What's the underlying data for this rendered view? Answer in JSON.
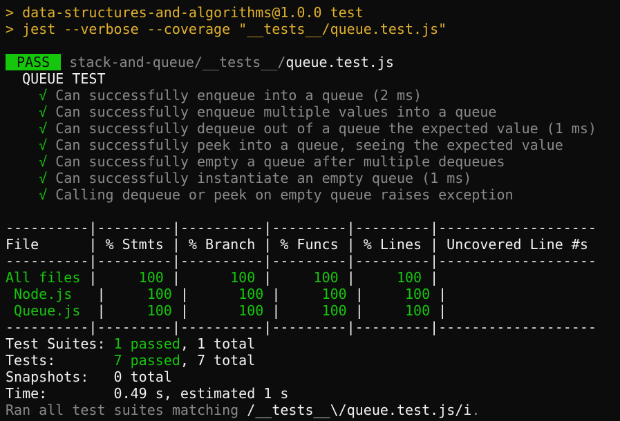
{
  "terminal": {
    "cmd_line1": "> data-structures-and-algorithms@1.0.0 test",
    "cmd_line2": "> jest --verbose --coverage \"__tests__/queue.test.js\"",
    "pass_badge": " PASS ",
    "test_path_dir": "stack-and-queue/__tests__/",
    "test_path_file": "queue.test.js",
    "describe_title": "QUEUE TEST",
    "check_mark": "√",
    "tests": [
      "Can successfully enqueue into a queue (2 ms)",
      "Can successfully enqueue multiple values into a queue",
      "Can successfully dequeue out of a queue the expected value (1 ms)",
      "Can successfully peek into a queue, seeing the expected value",
      "Can successfully empty a queue after multiple dequeues",
      "Can successfully instantiate an empty queue (1 ms)",
      "Calling dequeue or peek on empty queue raises exception"
    ],
    "coverage": {
      "separator": "----------|---------|----------|---------|---------|-------------------",
      "header": "File      | % Stmts | % Branch | % Funcs | % Lines | Uncovered Line #s ",
      "rows": [
        {
          "file": "All files",
          "stmts": "100",
          "branch": "100",
          "funcs": "100",
          "lines": "100"
        },
        {
          "file": " Node.js",
          "stmts": "100",
          "branch": "100",
          "funcs": "100",
          "lines": "100"
        },
        {
          "file": " Queue.js",
          "stmts": "100",
          "branch": "100",
          "funcs": "100",
          "lines": "100"
        }
      ]
    },
    "summary": {
      "suites_label": "Test Suites: ",
      "suites_passed": "1 passed",
      "suites_total": ", 1 total",
      "tests_label": "Tests:       ",
      "tests_passed": "7 passed",
      "tests_total": ", 7 total",
      "snapshots_label": "Snapshots:   ",
      "snapshots_value": "0 total",
      "time_label": "Time:        ",
      "time_value": "0.49 s, estimated 1 s",
      "ran_prefix": "Ran all test suites matching ",
      "ran_pattern": "/__tests__\\/queue.test.js/i",
      "ran_suffix": "."
    }
  }
}
